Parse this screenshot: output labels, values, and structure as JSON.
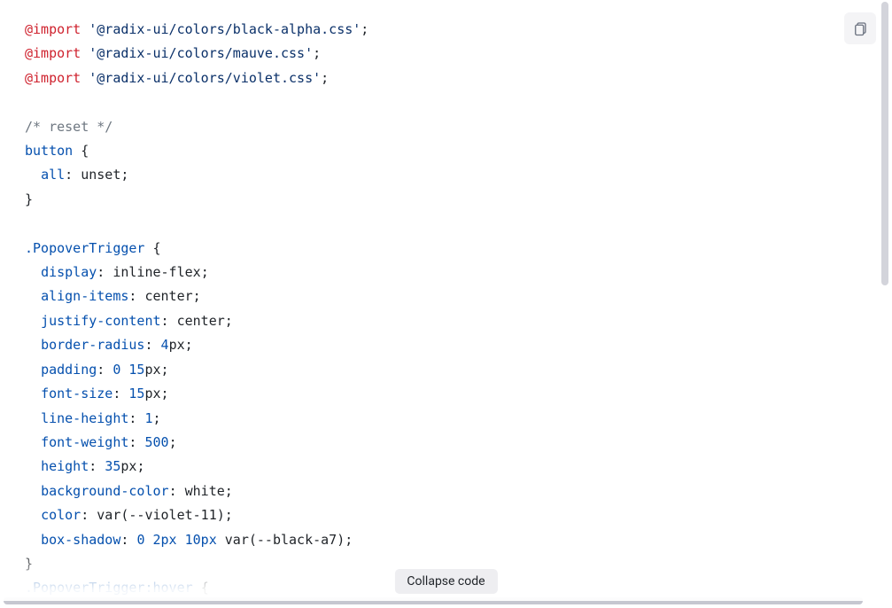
{
  "copy_button_label": "Copy",
  "collapse_button_label": "Collapse code",
  "code": {
    "imports": [
      "@radix-ui/colors/black-alpha.css",
      "@radix-ui/colors/mauve.css",
      "@radix-ui/colors/violet.css"
    ],
    "comment_reset": "/* reset */",
    "button_rule": {
      "selector": "button",
      "declarations": [
        {
          "prop": "all",
          "value": "unset"
        }
      ]
    },
    "popover_trigger_rule": {
      "selector": ".PopoverTrigger",
      "declarations": [
        {
          "prop": "display",
          "value": "inline-flex"
        },
        {
          "prop": "align-items",
          "value": "center"
        },
        {
          "prop": "justify-content",
          "value": "center"
        },
        {
          "prop": "border-radius",
          "value_num": "4",
          "unit": "px"
        },
        {
          "prop": "padding",
          "value_num": "0",
          "value_num2": "15",
          "unit": "px"
        },
        {
          "prop": "font-size",
          "value_num": "15",
          "unit": "px"
        },
        {
          "prop": "line-height",
          "value_num": "1"
        },
        {
          "prop": "font-weight",
          "value_num": "500"
        },
        {
          "prop": "height",
          "value_num": "35",
          "unit": "px"
        },
        {
          "prop": "background-color",
          "value": "white"
        },
        {
          "prop": "color",
          "func": "var",
          "arg": "--violet-11"
        },
        {
          "prop": "box-shadow",
          "parts": [
            "0",
            "2px",
            "10px"
          ],
          "func": "var",
          "arg": "--black-a7"
        }
      ]
    },
    "popover_trigger_hover_selector": ".PopoverTrigger:hover"
  }
}
